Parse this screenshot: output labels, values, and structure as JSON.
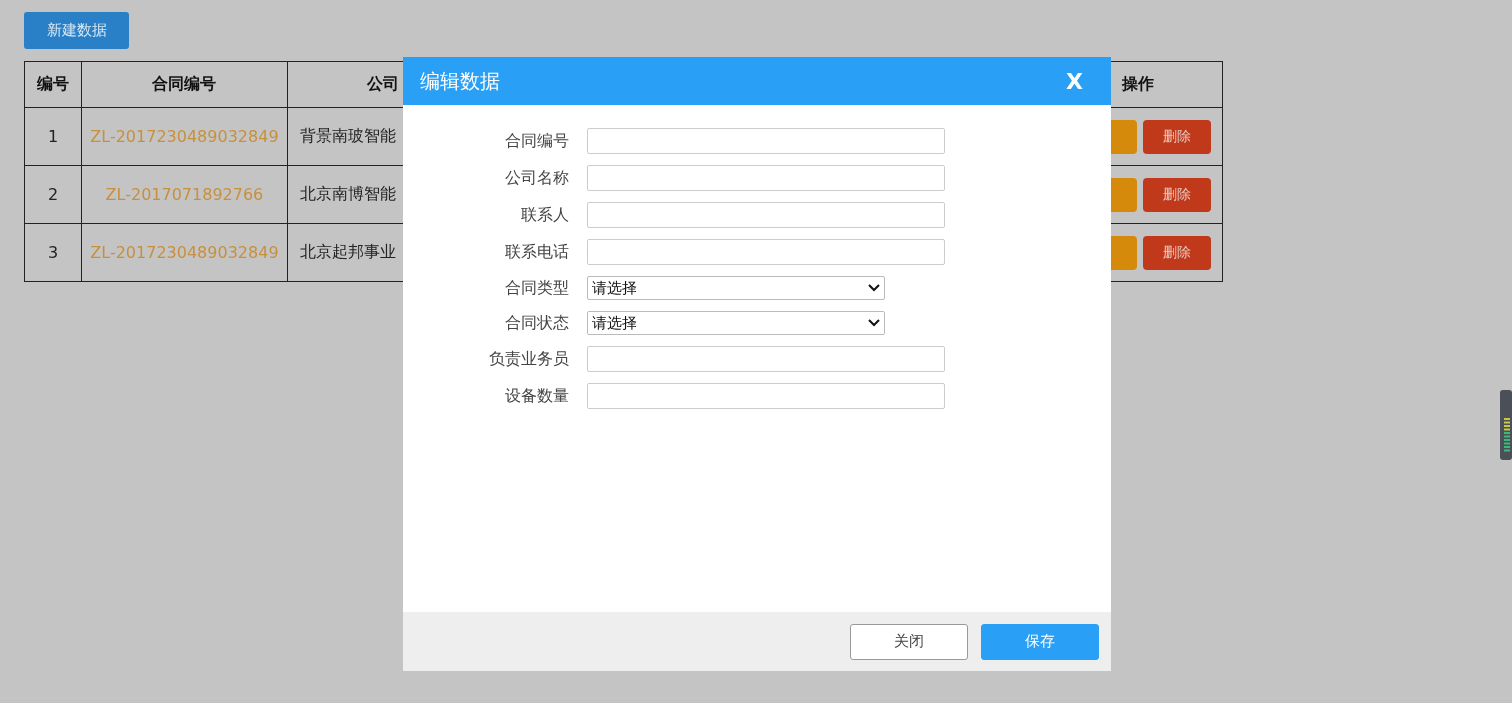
{
  "new_button": "新建数据",
  "table": {
    "columns": [
      "编号",
      "合同编号",
      "公司",
      "操作"
    ],
    "rows": [
      {
        "index": "1",
        "contract_no": "ZL-2017230489032849",
        "company": "背景南玻智能",
        "delete": "删除"
      },
      {
        "index": "2",
        "contract_no": "ZL-2017071892766",
        "company": "北京南博智能",
        "delete": "删除"
      },
      {
        "index": "3",
        "contract_no": "ZL-2017230489032849",
        "company": "北京起邦事业",
        "delete": "删除"
      }
    ]
  },
  "dialog": {
    "title": "编辑数据",
    "close": "X",
    "fields": [
      {
        "label": "合同编号",
        "kind": "text"
      },
      {
        "label": "公司名称",
        "kind": "text"
      },
      {
        "label": "联系人",
        "kind": "text"
      },
      {
        "label": "联系电话",
        "kind": "text"
      },
      {
        "label": "合同类型",
        "kind": "select",
        "value": "请选择"
      },
      {
        "label": "合同状态",
        "kind": "select",
        "value": "请选择"
      },
      {
        "label": "负责业务员",
        "kind": "text"
      },
      {
        "label": "设备数量",
        "kind": "text"
      }
    ],
    "buttons": [
      {
        "label": "关闭",
        "kind": "secondary"
      },
      {
        "label": "保存",
        "kind": "primary"
      }
    ]
  }
}
